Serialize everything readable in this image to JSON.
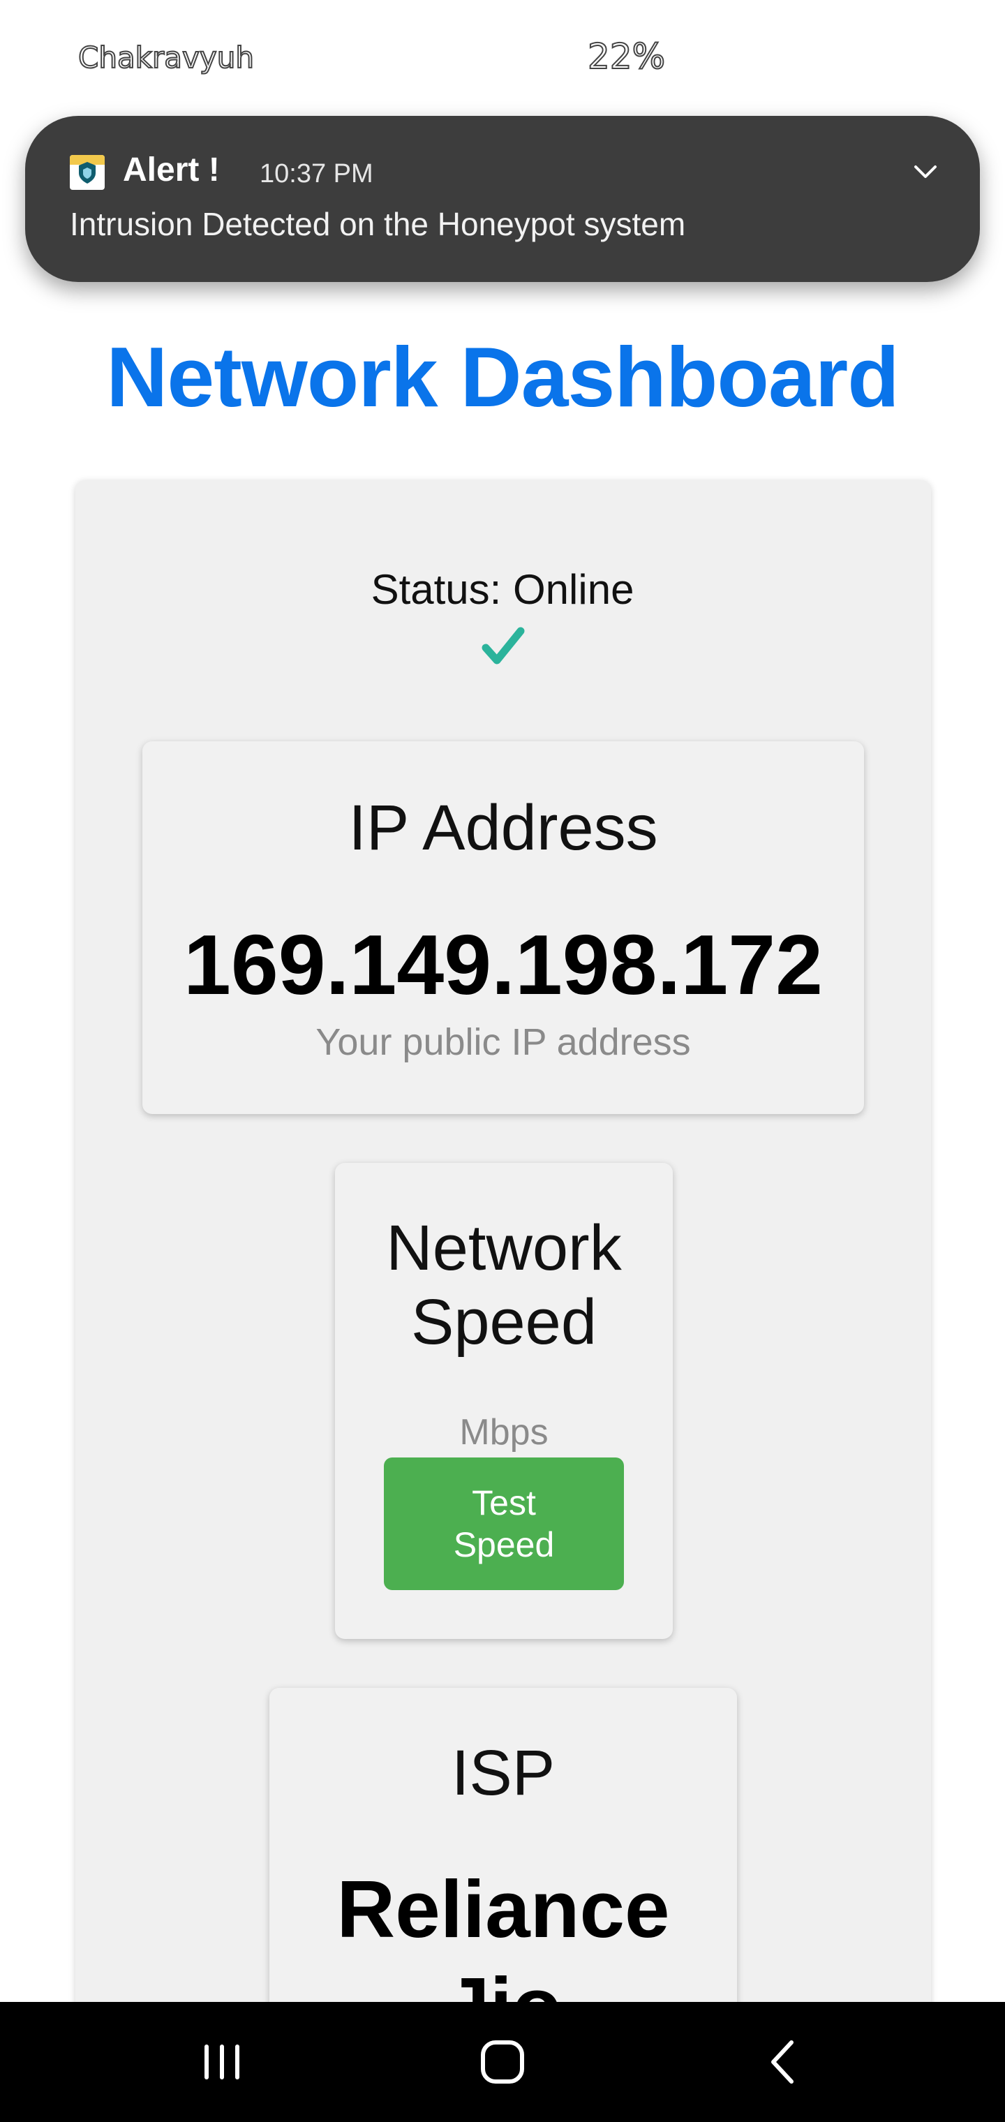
{
  "status_bar": {
    "left_text": "Chakravyuh",
    "battery": "22%"
  },
  "notification": {
    "app_icon": "shield-app-icon",
    "title": "Alert !",
    "time": "10:37 PM",
    "body": "Intrusion Detected on the Honeypot system",
    "expand_icon": "chevron-down-icon"
  },
  "dashboard": {
    "title": "Network Dashboard",
    "status": "Status: Online",
    "status_icon": "check-icon",
    "status_color": "#2bb39b",
    "accent_color": "#0a74ea",
    "button_color": "#4caf50"
  },
  "ip_card": {
    "title": "IP Address",
    "value": "169.149.198.172",
    "note": "Your public IP address"
  },
  "speed_card": {
    "title": "Network Speed",
    "unit": "Mbps",
    "button_label": "Test Speed"
  },
  "isp_card": {
    "title": "ISP",
    "value": "Reliance Jio"
  },
  "nav": {
    "recent_icon": "recent-apps-icon",
    "home_icon": "home-icon",
    "back_icon": "back-icon"
  }
}
